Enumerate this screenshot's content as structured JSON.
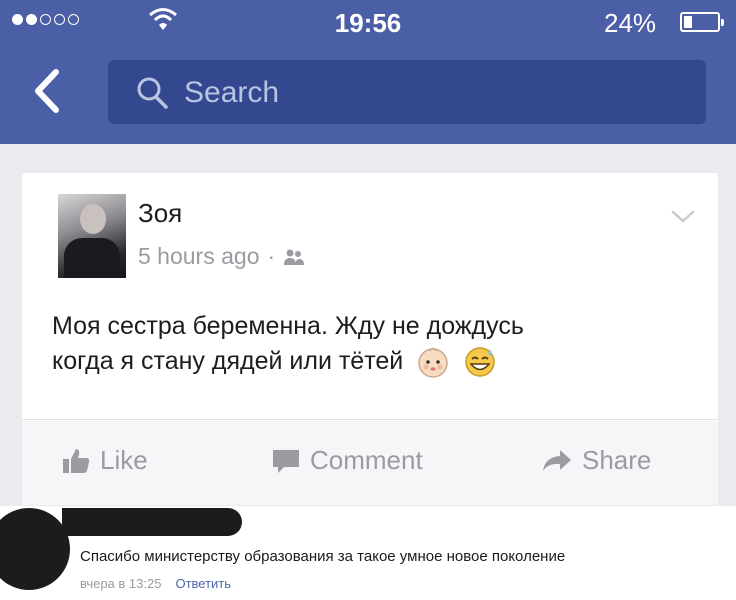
{
  "status_bar": {
    "signal_filled": 2,
    "signal_total": 5,
    "time": "19:56",
    "battery_percent_label": "24%",
    "battery_level": 0.24
  },
  "nav": {
    "search_placeholder": "Search"
  },
  "post": {
    "author": "Зоя",
    "time_ago": "5 hours ago",
    "separator": "·",
    "audience_icon": "friends-icon",
    "text_line1": "Моя сестра беременна. Жду не дождусь",
    "text_line2": "когда я стану дядей или тётей",
    "emojis": [
      "baby-face-icon",
      "grinning-sweat-icon"
    ]
  },
  "actions": {
    "like": "Like",
    "comment": "Comment",
    "share": "Share"
  },
  "comment": {
    "text": "Спасибо министерству образования за такое умное новое поколение",
    "timestamp": "вчера в 13:25",
    "reply": "Ответить"
  },
  "colors": {
    "brand": "#4b5fa6",
    "search_field": "#33488f",
    "reply_link": "#4b67a8",
    "muted_text": "#9a9ca2"
  }
}
